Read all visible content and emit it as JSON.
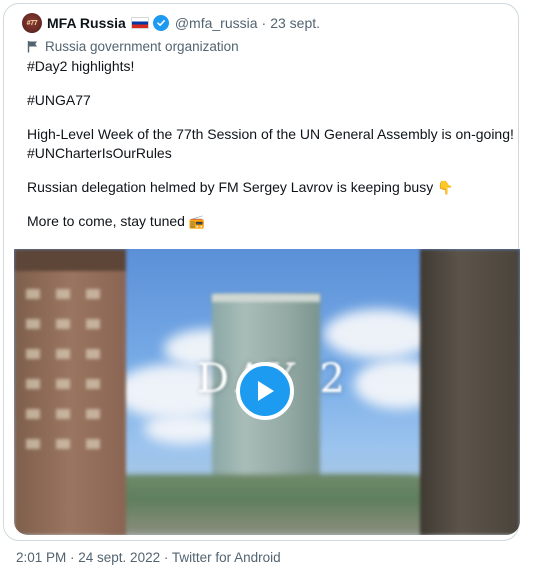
{
  "tweet": {
    "avatar_text": "#77",
    "display_name": "MFA Russia",
    "handle": "@mfa_russia",
    "date": "23 sept.",
    "org_label": "Russia government organization",
    "lines": [
      "#Day2 highlights!",
      "",
      "#UNGA77",
      "",
      "High-Level Week of the 77th Session of the UN General Assembly is on-going!",
      "#UNCharterIsOurRules",
      "",
      "Russian delegation helmed by FM Sergey Lavrov is keeping busy",
      "",
      "More to come, stay tuned"
    ],
    "emoji_busy": "👇",
    "emoji_tuned": "📻",
    "video_overlay_text": "DAY 2",
    "footer": "2:01 PM · 24 sept. 2022 · Twitter for Android"
  },
  "colors": {
    "accent": "#1d9bf0",
    "text": "#0f1419",
    "muted": "#536471",
    "border": "#cfd9de"
  },
  "icons": {
    "verified": "verified-badge-icon",
    "org": "flag-icon",
    "play": "play-icon",
    "country_flag": "russia-flag-icon"
  }
}
